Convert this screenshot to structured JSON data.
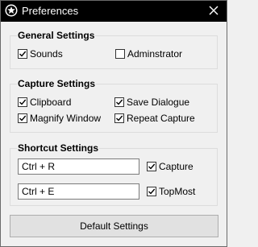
{
  "window": {
    "title": "Preferences",
    "app_icon": "star-badge-icon",
    "close_icon": "close-icon"
  },
  "general": {
    "title": "General Settings",
    "sounds": {
      "label": "Sounds",
      "checked": true
    },
    "administrator": {
      "label": "Adminstrator",
      "checked": false
    }
  },
  "capture": {
    "title": "Capture Settings",
    "clipboard": {
      "label": "Clipboard",
      "checked": true
    },
    "save_dialogue": {
      "label": "Save Dialogue",
      "checked": true
    },
    "magnify_window": {
      "label": "Magnify Window",
      "checked": true
    },
    "repeat_capture": {
      "label": "Repeat Capture",
      "checked": true
    }
  },
  "shortcut": {
    "title": "Shortcut Settings",
    "capture_hotkey": "Ctrl + R",
    "capture": {
      "label": "Capture",
      "checked": true
    },
    "topmost_hotkey": "Ctrl + E",
    "topmost": {
      "label": "TopMost",
      "checked": true
    }
  },
  "default_button": "Default Settings"
}
